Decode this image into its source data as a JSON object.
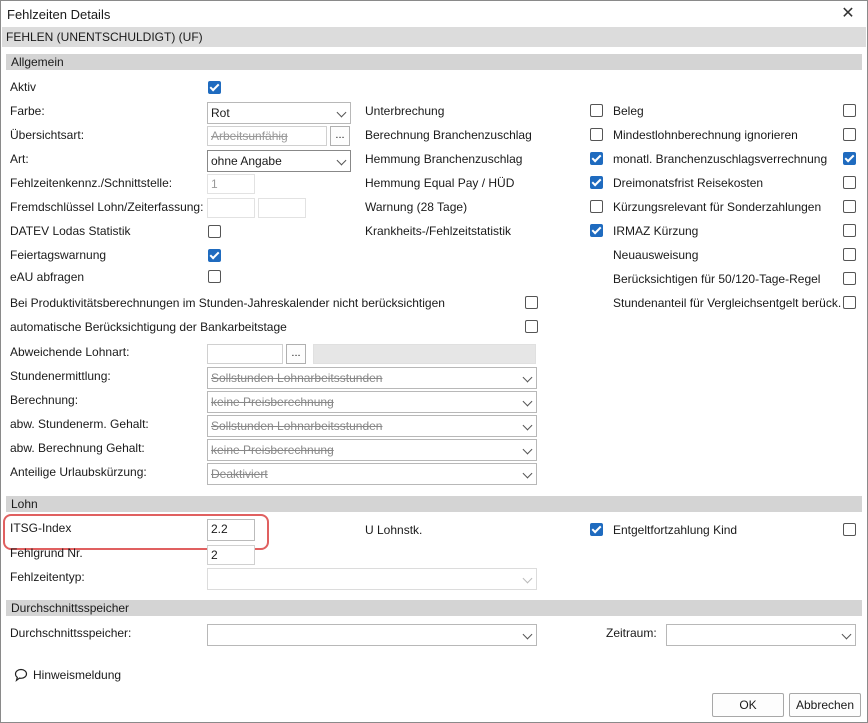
{
  "window": {
    "title": "Fehlzeiten Details",
    "subtitle": "FEHLEN (UNENTSCHULDIGT) (UF)"
  },
  "sections": {
    "allgemein": "Allgemein",
    "lohn": "Lohn",
    "durchschnitt": "Durchschnittsspeicher"
  },
  "allgemein": {
    "aktiv": {
      "label": "Aktiv",
      "checked": true
    },
    "farbe": {
      "label": "Farbe:",
      "value": "Rot"
    },
    "uebersichtsart": {
      "label": "Übersichtsart:",
      "value": "Arbeitsunfähig"
    },
    "art": {
      "label": "Art:",
      "value": "ohne Angabe"
    },
    "fehlzeitenkennz": {
      "label": "Fehlzeitenkennz./Schnittstelle:",
      "value": "1"
    },
    "fremdschluessel": {
      "label": "Fremdschlüssel Lohn/Zeiterfassung:"
    },
    "datev": {
      "label": "DATEV Lodas Statistik",
      "checked": false
    },
    "feiertag": {
      "label": "Feiertagswarnung",
      "checked": true
    },
    "eau": {
      "label": "eAU abfragen",
      "checked": false
    },
    "produktivitaet": {
      "label": "Bei Produktivitätsberechnungen im Stunden-Jahreskalender nicht berücksichtigen",
      "checked": false
    },
    "bankarbeitstage": {
      "label": "automatische Berücksichtigung der Bankarbeitstage",
      "checked": false
    },
    "abw_lohnart": {
      "label": "Abweichende Lohnart:"
    },
    "stundenermittlung": {
      "label": "Stundenermittlung:",
      "value": "Sollstunden Lohnarbeitsstunden"
    },
    "berechnung": {
      "label": "Berechnung:",
      "value": "keine Preisberechnung"
    },
    "abw_stunden_gehalt": {
      "label": "abw. Stundenerm. Gehalt:",
      "value": "Sollstunden Lohnarbeitsstunden"
    },
    "abw_berechnung_gehalt": {
      "label": "abw. Berechnung Gehalt:",
      "value": "keine Preisberechnung"
    },
    "urlaubskuerzung": {
      "label": "Anteilige Urlaubskürzung:",
      "value": "Deaktiviert"
    },
    "col2": [
      {
        "label": "Unterbrechung",
        "checked": false
      },
      {
        "label": "Berechnung Branchenzuschlag",
        "checked": false
      },
      {
        "label": "Hemmung Branchenzuschlag",
        "checked": true
      },
      {
        "label": "Hemmung Equal Pay / HÜD",
        "checked": true
      },
      {
        "label": "Warnung (28 Tage)",
        "checked": false
      },
      {
        "label": "Krankheits-/Fehlzeitstatistik",
        "checked": true
      }
    ],
    "col3": [
      {
        "label": "Beleg",
        "checked": false
      },
      {
        "label": "Mindestlohnberechnung ignorieren",
        "checked": false
      },
      {
        "label": "monatl. Branchenzuschlagsverrechnung",
        "checked": true
      },
      {
        "label": "Dreimonatsfrist Reisekosten",
        "checked": false
      },
      {
        "label": "Kürzungsrelevant für Sonderzahlungen",
        "checked": false
      },
      {
        "label": "IRMAZ Kürzung",
        "checked": false
      },
      {
        "label": "Neuausweisung",
        "checked": false
      },
      {
        "label": "Berücksichtigen für 50/120-Tage-Regel",
        "checked": false
      },
      {
        "label": "Stundenanteil für Vergleichsentgelt berück.",
        "checked": false
      }
    ]
  },
  "lohn": {
    "itsg": {
      "label": "ITSG-Index",
      "value": "2.2"
    },
    "u_lohnstk": {
      "label": "U Lohnstk.",
      "checked": true
    },
    "entgelt": {
      "label": "Entgeltfortzahlung Kind",
      "checked": false
    },
    "fehlgrund": {
      "label": "Fehlgrund Nr.",
      "value": "2"
    },
    "fehlzeitentyp": {
      "label": "Fehlzeitentyp:",
      "value": ""
    }
  },
  "durchschnitt": {
    "speicher": {
      "label": "Durchschnittsspeicher:",
      "value": ""
    },
    "zeitraum": {
      "label": "Zeitraum:",
      "value": ""
    }
  },
  "footer": {
    "hint": "Hinweismeldung",
    "ok": "OK",
    "cancel": "Abbrechen"
  },
  "colors": {
    "accent": "#1f6bbf",
    "highlight": "#e06060",
    "section": "#d4d4d4"
  },
  "icons": {
    "close": "close-icon",
    "hint": "speech-bubble-icon"
  }
}
